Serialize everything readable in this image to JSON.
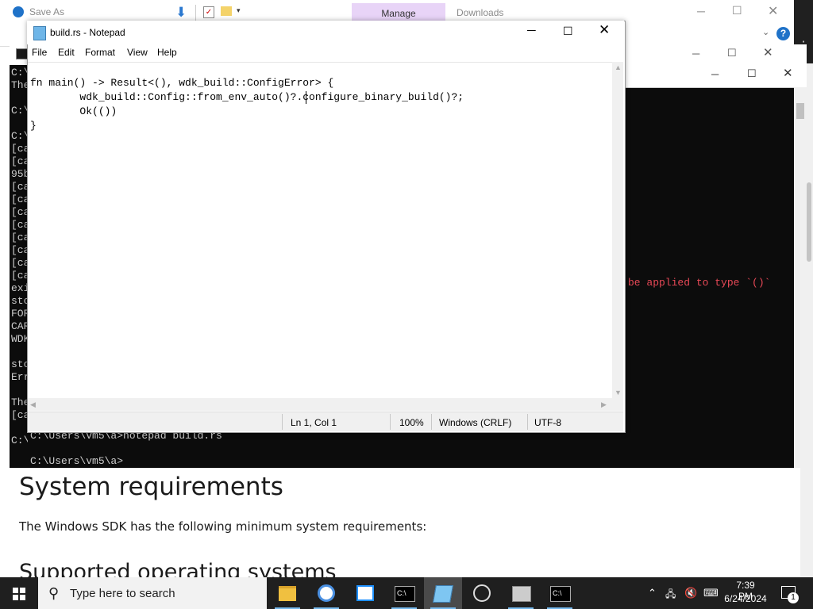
{
  "web_page": {
    "heading": "System requirements",
    "paragraph": "The Windows SDK has the following minimum system requirements:",
    "subheading": "Supported operating systems"
  },
  "save_as": {
    "title": "Save As",
    "manage_tab": "Manage",
    "downloads_label": "Downloads",
    "help_glyph": "?"
  },
  "console1": {
    "lines": [
      "C:\\",
      "The",
      "",
      "C:\\",
      "",
      "C:\\",
      "[ca",
      "[ca",
      "95b",
      "[ca",
      "[ca",
      "[ca",
      "[ca",
      "[ca",
      "[ca",
      "[ca",
      "[ca",
      "exi",
      "sto",
      "FOR",
      "CAR",
      "WDK",
      "",
      "sto",
      "Err",
      "",
      "The",
      "[ca",
      "",
      "C:\\"
    ],
    "command_line": "C:\\Users\\vm5\\a>notepad build.rs",
    "prompt_line": "C:\\Users\\vm5\\a>"
  },
  "console2": {
    "error_text": "be applied to type `()`"
  },
  "notepad": {
    "title": "build.rs - Notepad",
    "menu": [
      "File",
      "Edit",
      "Format",
      "View",
      "Help"
    ],
    "code_lines": [
      "fn main() -> Result<(), wdk_build::ConfigError> {",
      "        wdk_build::Config::from_env_auto()?.configure_binary_build()?;",
      "        Ok(())",
      "}"
    ],
    "status": {
      "position": "Ln 1, Col 1",
      "zoom": "100%",
      "line_ending": "Windows (CRLF)",
      "encoding": "UTF-8"
    }
  },
  "taskbar": {
    "search_placeholder": "Type here to search",
    "apps": [
      "file-explorer",
      "chrome",
      "microsoft-store",
      "command-prompt",
      "notepad",
      "obs-studio",
      "photos",
      "command-prompt-2"
    ],
    "clock_time": "7:39 PM",
    "clock_date": "6/24/2024",
    "notification_count": "1"
  },
  "icons": {
    "minimize": "─",
    "maximize": "☐",
    "close": "✕",
    "chevron_up": "⌃",
    "search": "⚲"
  }
}
